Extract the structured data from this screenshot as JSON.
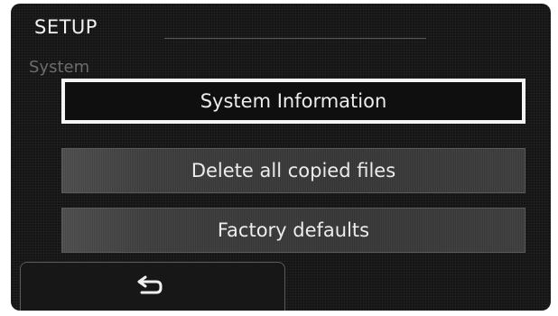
{
  "header": {
    "title": "SETUP"
  },
  "section": {
    "label": "System"
  },
  "menu": {
    "items": [
      {
        "label": "System Information",
        "selected": true
      },
      {
        "label": "Delete all copied files",
        "selected": false
      },
      {
        "label": "Factory defaults",
        "selected": false
      }
    ]
  },
  "footer": {
    "back_icon": "return-arrow-icon"
  },
  "colors": {
    "screen_background": "#141414",
    "text": "#ececec",
    "selection_border": "#f4f4f4",
    "muted_label": "#6c6c6c"
  }
}
